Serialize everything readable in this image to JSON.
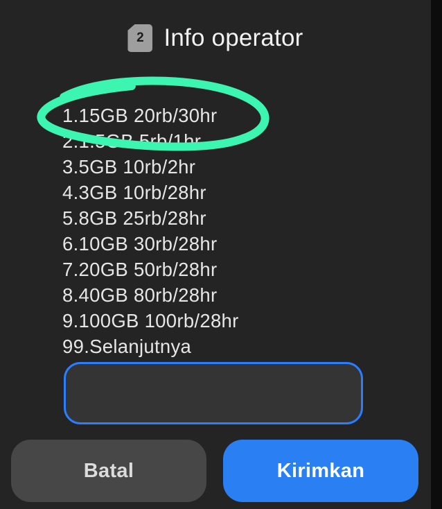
{
  "dialog": {
    "sim_badge": "2",
    "title": "Info operator",
    "menu_lines": [
      "1.15GB 20rb/30hr",
      "2.1.5GB 5rb/1hr",
      "3.5GB 10rb/2hr",
      "4.3GB 10rb/28hr",
      "5.8GB 25rb/28hr",
      "6.10GB 30rb/28hr",
      "7.20GB 50rb/28hr",
      "8.40GB 80rb/28hr",
      "9.100GB 100rb/28hr",
      "99.Selanjutnya"
    ],
    "reply_value": "",
    "cancel_label": "Batal",
    "send_label": "Kirimkan"
  },
  "colors": {
    "background": "#242424",
    "accent": "#2a7ff2",
    "highlight_marker": "#3cf5b0"
  },
  "icons": {
    "sim": "sim-card-icon"
  }
}
